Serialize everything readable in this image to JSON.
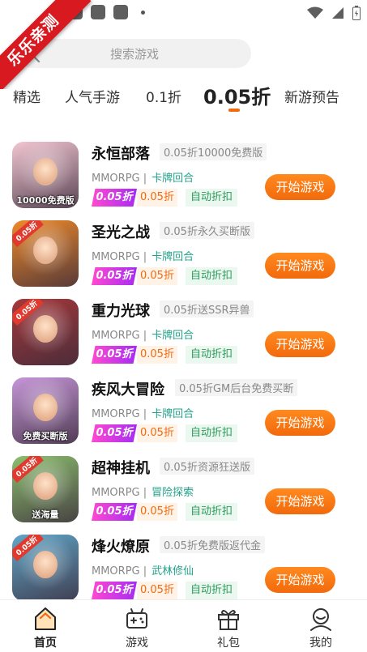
{
  "ribbon": {
    "text": "乐乐亲测"
  },
  "search": {
    "placeholder": "搜索游戏"
  },
  "tabs": [
    {
      "label": "精选",
      "active": false
    },
    {
      "label": "人气手游",
      "active": false
    },
    {
      "label": "0.1折",
      "active": false
    },
    {
      "label": "0.05折",
      "active": true
    },
    {
      "label": "新游预告",
      "active": false
    }
  ],
  "games": [
    {
      "name": "永恒部落",
      "subtitle": "0.05折10000免费版",
      "type": "MMORPG |",
      "genre": "卡牌回合",
      "badge": "0.05折",
      "price": "0.05折",
      "discount_tag": "自动折扣",
      "button": "开始游戏",
      "thumb_banner": "10000免费版",
      "thumb_tag": "",
      "thumb_color": "#f3c6d2"
    },
    {
      "name": "圣光之战",
      "subtitle": "0.05折永久买断版",
      "type": "MMORPG |",
      "genre": "卡牌回合",
      "badge": "0.05折",
      "price": "0.05折",
      "discount_tag": "自动折扣",
      "button": "开始游戏",
      "thumb_banner": "",
      "thumb_tag": "0.05折",
      "thumb_color": "#ee8a2a"
    },
    {
      "name": "重力光球",
      "subtitle": "0.05折送SSR异兽",
      "type": "MMORPG |",
      "genre": "卡牌回合",
      "badge": "0.05折",
      "price": "0.05折",
      "discount_tag": "自动折扣",
      "button": "开始游戏",
      "thumb_banner": "",
      "thumb_tag": "0.05折",
      "thumb_color": "#a5383a"
    },
    {
      "name": "疾风大冒险",
      "subtitle": "0.05折GM后台免费买断",
      "type": "MMORPG |",
      "genre": "卡牌回合",
      "badge": "0.05折",
      "price": "0.05折",
      "discount_tag": "自动折扣",
      "button": "开始游戏",
      "thumb_banner": "免费买断版",
      "thumb_tag": "",
      "thumb_color": "#c696d8"
    },
    {
      "name": "超神挂机",
      "subtitle": "0.05折资源狂送版",
      "type": "MMORPG |",
      "genre": "冒险探索",
      "badge": "0.05折",
      "price": "0.05折",
      "discount_tag": "自动折扣",
      "button": "开始游戏",
      "thumb_banner": "送海量",
      "thumb_tag": "0.05折",
      "thumb_color": "#8cbf6e"
    },
    {
      "name": "烽火燎原",
      "subtitle": "0.05折免费版返代金",
      "type": "MMORPG |",
      "genre": "武林修仙",
      "badge": "0.05折",
      "price": "0.05折",
      "discount_tag": "自动折扣",
      "button": "开始游戏",
      "thumb_banner": "",
      "thumb_tag": "0.05折",
      "thumb_color": "#5fa6c8"
    }
  ],
  "bottom_nav": [
    {
      "label": "首页",
      "icon": "home-icon",
      "active": true
    },
    {
      "label": "游戏",
      "icon": "gamepad-icon",
      "active": false
    },
    {
      "label": "礼包",
      "icon": "gift-icon",
      "active": false
    },
    {
      "label": "我的",
      "icon": "profile-icon",
      "active": false
    }
  ],
  "colors": {
    "accent": "#f06a10",
    "genre": "#23a18a",
    "ribbon": "#d8191f"
  }
}
